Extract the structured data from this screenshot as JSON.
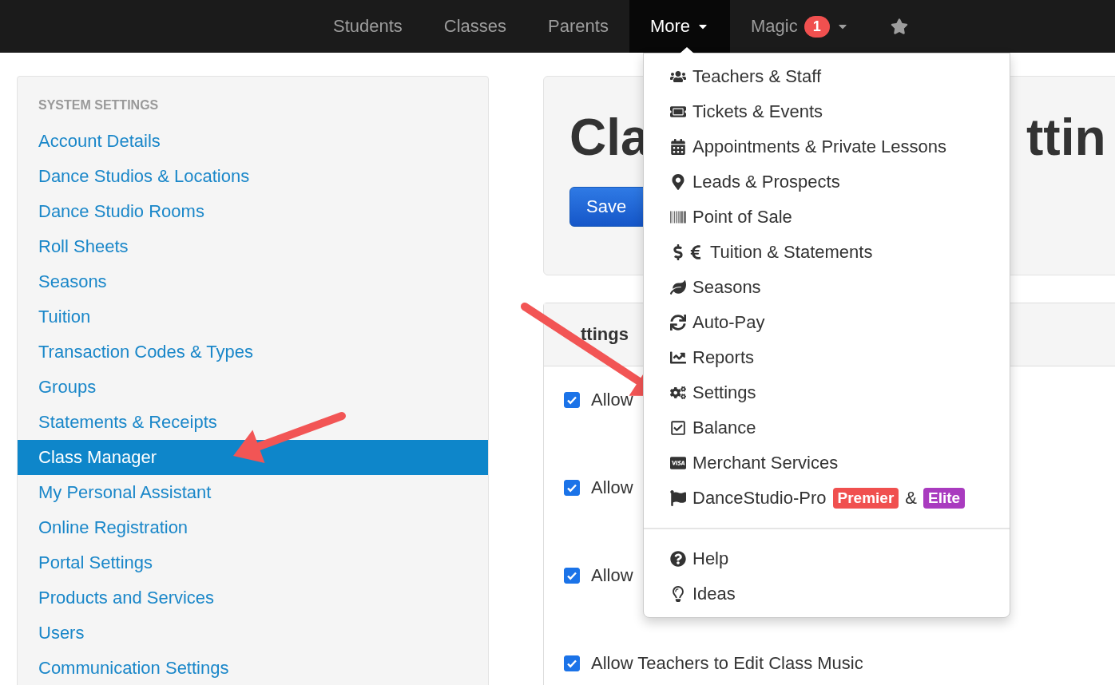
{
  "navbar": {
    "items": [
      {
        "label": "Students",
        "selected": false,
        "caret": false
      },
      {
        "label": "Classes",
        "selected": false,
        "caret": false
      },
      {
        "label": "Parents",
        "selected": false,
        "caret": false
      },
      {
        "label": "More",
        "selected": true,
        "caret": true
      },
      {
        "label": "Magic",
        "selected": false,
        "caret": true,
        "badge": "1"
      }
    ]
  },
  "sidebar": {
    "heading": "SYSTEM SETTINGS",
    "items": [
      {
        "label": "Account Details",
        "selected": false
      },
      {
        "label": "Dance Studios & Locations",
        "selected": false
      },
      {
        "label": "Dance Studio Rooms",
        "selected": false
      },
      {
        "label": "Roll Sheets",
        "selected": false
      },
      {
        "label": "Seasons",
        "selected": false
      },
      {
        "label": "Tuition",
        "selected": false
      },
      {
        "label": "Transaction Codes & Types",
        "selected": false
      },
      {
        "label": "Groups",
        "selected": false
      },
      {
        "label": "Statements & Receipts",
        "selected": false
      },
      {
        "label": "Class Manager",
        "selected": true
      },
      {
        "label": "My Personal Assistant",
        "selected": false
      },
      {
        "label": "Online Registration",
        "selected": false
      },
      {
        "label": "Portal Settings",
        "selected": false
      },
      {
        "label": "Products and Services",
        "selected": false
      },
      {
        "label": "Users",
        "selected": false
      },
      {
        "label": "Communication Settings",
        "selected": false
      }
    ]
  },
  "header": {
    "title_start": "Cla",
    "title_end": "ttin",
    "save_button": "Save"
  },
  "settings": {
    "title": "ttings",
    "options": [
      {
        "label": "Allow",
        "checked": true
      },
      {
        "label": "Allow",
        "checked": true
      },
      {
        "label": "Allow",
        "checked": true
      },
      {
        "label": "Allow Teachers to Edit Class Music",
        "checked": true
      }
    ]
  },
  "dropdown": {
    "sections": [
      {
        "items": [
          {
            "label": "Teachers & Staff"
          },
          {
            "label": "Tickets & Events"
          },
          {
            "label": "Appointments & Private Lessons"
          },
          {
            "label": "Leads & Prospects"
          },
          {
            "label": "Point of Sale"
          },
          {
            "label": "Tuition & Statements"
          },
          {
            "label": "Seasons"
          },
          {
            "label": "Auto-Pay"
          },
          {
            "label": "Reports"
          },
          {
            "label": "Settings"
          },
          {
            "label": "Balance"
          },
          {
            "label": "Merchant Services"
          },
          {
            "label": "DanceStudio-Pro",
            "joiner": "&",
            "badges": [
              {
                "text": "Premier",
                "color": "#f0504f"
              },
              {
                "text": "Elite",
                "color": "#a93bbf"
              }
            ]
          }
        ]
      },
      {
        "items": [
          {
            "label": "Help"
          },
          {
            "label": "Ideas"
          }
        ]
      }
    ]
  }
}
